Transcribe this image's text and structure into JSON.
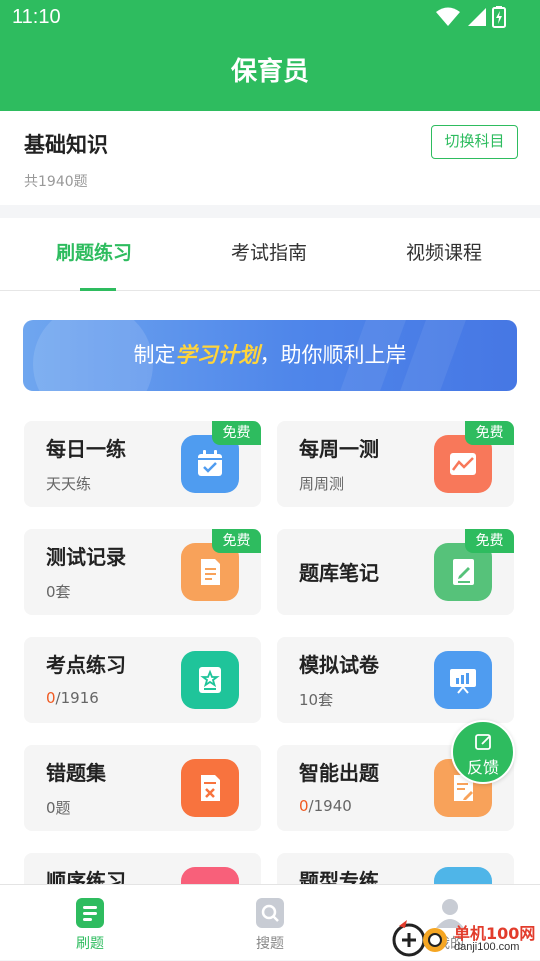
{
  "status_bar": {
    "time": "11:10"
  },
  "header": {
    "title": "保育员"
  },
  "subject": {
    "name": "基础知识",
    "count": "共1940题",
    "switch_label": "切换科目"
  },
  "tabs": [
    {
      "label": "刷题练习",
      "active": true
    },
    {
      "label": "考试指南",
      "active": false
    },
    {
      "label": "视频课程",
      "active": false
    }
  ],
  "banner": {
    "prefix": "制定",
    "highlight": "学习计划",
    "suffix": "，助你顺利上岸"
  },
  "cards": [
    {
      "title": "每日一练",
      "sub": "天天练",
      "badge": "免费",
      "icon": "calendar-icon",
      "color": "#4f9cf0"
    },
    {
      "title": "每周一测",
      "sub": "周周测",
      "badge": "免费",
      "icon": "chart-icon",
      "color": "#f8785a"
    },
    {
      "title": "测试记录",
      "sub": "0套",
      "badge": "免费",
      "icon": "document-icon",
      "color": "#f8a25a"
    },
    {
      "title": "题库笔记",
      "sub": "",
      "badge": "免费",
      "icon": "notebook-icon",
      "color": "#56c27a"
    },
    {
      "title": "考点练习",
      "sub_highlight": "0",
      "sub": "/1916",
      "badge": "",
      "icon": "star-book-icon",
      "color": "#1fc49a"
    },
    {
      "title": "模拟试卷",
      "sub": "10套",
      "badge": "",
      "icon": "presentation-icon",
      "color": "#4f9cf0"
    },
    {
      "title": "错题集",
      "sub": "0题",
      "badge": "",
      "icon": "wrong-doc-icon",
      "color": "#f8733e"
    },
    {
      "title": "智能出题",
      "sub_highlight": "0",
      "sub": "/1940",
      "badge": "",
      "icon": "edit-doc-icon",
      "color": "#f8a25a"
    },
    {
      "title": "顺序练习",
      "sub": "",
      "badge": "",
      "icon": "order-icon",
      "color": "#f8607a"
    },
    {
      "title": "题型专练",
      "sub": "",
      "badge": "",
      "icon": "type-icon",
      "color": "#4fb5e8"
    }
  ],
  "feedback": {
    "label": "反馈"
  },
  "bottom_nav": [
    {
      "label": "刷题",
      "active": true
    },
    {
      "label": "搜题",
      "active": false
    },
    {
      "label": "我的",
      "active": false
    }
  ],
  "watermark": {
    "title": "单机100网",
    "url": "danji100.com"
  }
}
